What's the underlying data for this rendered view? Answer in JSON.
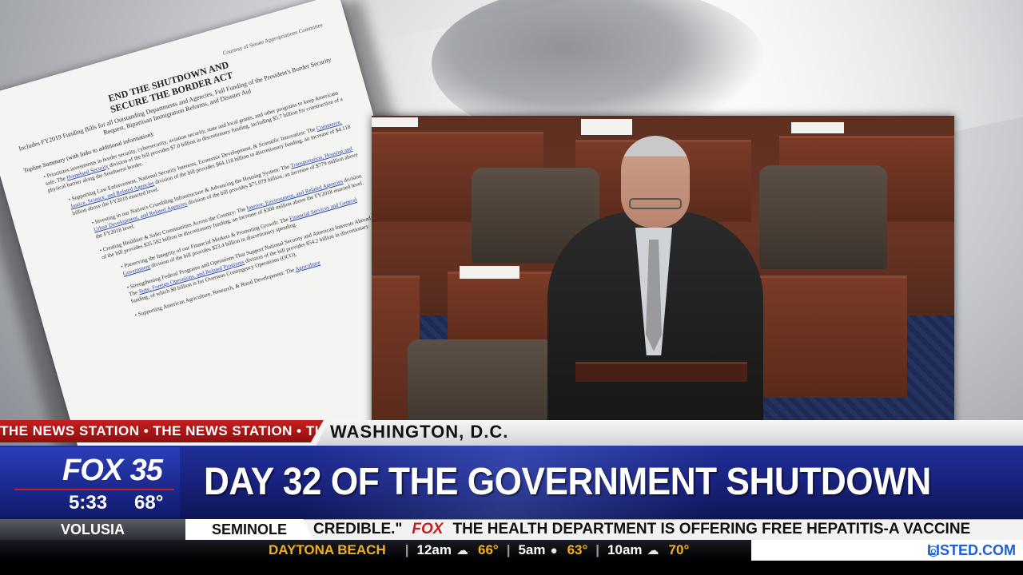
{
  "document": {
    "courtesy": "Courtesy of Senate Appropriations Committee",
    "title_line1": "END THE SHUTDOWN AND",
    "title_line2": "SECURE THE BORDER ACT",
    "subtitle": "Includes FY2019 Funding Bills for all Outstanding Departments and Agencies, Full Funding of the President's Border Security Request, Bipartisan Immigration Reforms, and Disaster Aid",
    "toc": "Topline Summary (with links to additional information):",
    "items": [
      {
        "text": "Prioritizes investments in border security, cybersecurity, aviation security, state and local grants, and other programs to keep Americans safe. The ",
        "link": "Homeland Security",
        "rest": " division of the bill provides $7.0 billion in discretionary funding, including $5.7 billion for construction of a physical barrier along the Southwest border."
      },
      {
        "text": "Supporting Law Enforcement, National Security Interests, Economic Development, & Scientific Innovation: The ",
        "link": "Commerce, Justice, Science, and Related Agencies",
        "rest": " division of the bill provides $64.118 billion in discretionary funding, an increase of $4.118 billion above the FY2018 enacted level."
      },
      {
        "text": "Investing in our Nation's Crumbling Infrastructure & Advancing the Housing System: The ",
        "link": "Transportation, Housing and Urban Development, and Related Agencies",
        "rest": " division of the bill provides $71.079 billion, an increase of $779 million above the FY2018 level."
      },
      {
        "text": "Creating Healthier & Safer Communities Across the Country: The ",
        "link": "Interior, Environment, and Related Agencies",
        "rest": " division of the bill provides $35.582 billion in discretionary funding, an increase of $300 million above the FY2018 enacted level."
      },
      {
        "text": "Preserving the Integrity of our Financial Markets & Promoting Growth: The ",
        "link": "Financial Services and General Government",
        "rest": " division of the bill provides $23.4 billion in discretionary spending."
      },
      {
        "text": "Strengthening Federal Programs and Operations That Support National Security and American Interests Abroad: The ",
        "link": "State, Foreign Operations, and Related Programs",
        "rest": " division of the bill provides $54.2 billion in discretionary funding, of which $8 billion is for Overseas Contingency Operations (OCO)."
      },
      {
        "text": "Supporting American Agriculture, Research, & Rural Development: The ",
        "link": "Agriculture",
        "rest": ""
      }
    ]
  },
  "lower_third": {
    "station_crawl": "THE NEWS STATION • THE NEWS STATION • THE NEWS STATION",
    "location": "WASHINGTON, D.C.",
    "logo": "FOX 35",
    "time": "5:33",
    "temperature": "68°",
    "headline": "DAY 32 OF THE GOVERNMENT SHUTDOWN"
  },
  "ticker": {
    "tabs": [
      "VOLUSIA",
      "SEMINOLE"
    ],
    "text_before": "CREDIBLE.\"",
    "fox_mark": "FOX",
    "text_after": "THE HEALTH DEPARTMENT IS OFFERING FREE HEPATITIS-A VACCINE"
  },
  "weather": {
    "city": "DAYTONA BEACH",
    "entries": [
      {
        "time": "12am",
        "icon": "☁",
        "icon_name": "partly-cloudy-icon",
        "temp": "66°"
      },
      {
        "time": "5am",
        "icon": "●",
        "icon_name": "clear-moon-icon",
        "temp": "63°"
      },
      {
        "time": "10am",
        "icon": "☁",
        "icon_name": "partly-sunny-icon",
        "temp": "70°"
      }
    ]
  },
  "sponsor": {
    "icon": "◎",
    "label": "LISTED.COM"
  },
  "colors": {
    "brand_red": "#c41e1e",
    "brand_blue": "#1a2380",
    "weather_accent": "#f2b01e",
    "sponsor_blue": "#1f5fd1"
  }
}
